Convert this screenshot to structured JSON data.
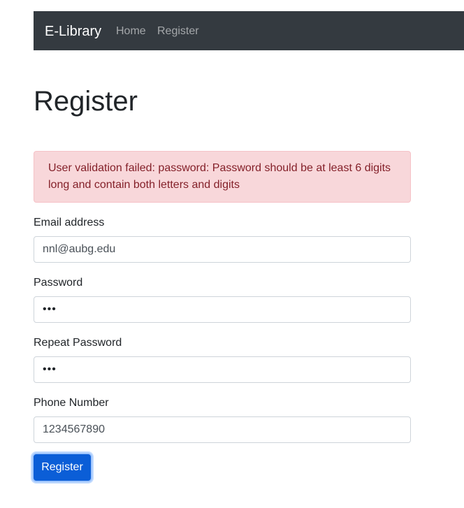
{
  "navbar": {
    "brand": "E-Library",
    "links": [
      "Home",
      "Register"
    ]
  },
  "page": {
    "title": "Register"
  },
  "alert": {
    "message_line1": "User validation failed: password: Password should be at least 6 digits",
    "message_line2": "long and contain both letters and digits"
  },
  "form": {
    "email": {
      "label": "Email address",
      "value": "nnl@aubg.edu"
    },
    "password": {
      "label": "Password",
      "value": "•••"
    },
    "repeat_password": {
      "label": "Repeat Password",
      "value": "•••"
    },
    "phone": {
      "label": "Phone Number",
      "value": "1234567890"
    },
    "submit_label": "Register"
  },
  "colors": {
    "navbar_bg": "#343a40",
    "alert_bg": "#f8d7da",
    "alert_text": "#842029",
    "button_bg": "#0b5ed7"
  }
}
